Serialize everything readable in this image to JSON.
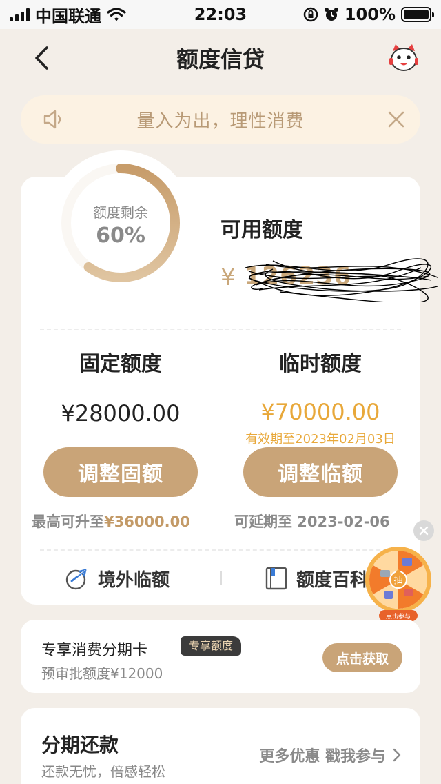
{
  "status_bar": {
    "carrier": "中国联通",
    "time": "22:03",
    "battery": "100%"
  },
  "nav": {
    "title": "额度信贷"
  },
  "notice": {
    "text": "量入为出，理性消费"
  },
  "credit": {
    "remaining_label": "额度剩余",
    "remaining_percent": "60%",
    "remaining_fraction": 0.6,
    "available_label": "可用额度",
    "currency": "¥",
    "available_amount_redacted": "126236"
  },
  "fixed": {
    "title": "固定额度",
    "amount": "¥28000.00",
    "button": "调整固额",
    "note_prefix": "最高可升至",
    "note_value": "¥36000.00"
  },
  "temporary": {
    "title": "临时额度",
    "amount": "¥70000.00",
    "expiry": "有效期至2023年02月03日",
    "button": "调整临额",
    "note": "可延期至 2023-02-06"
  },
  "quick_links": {
    "overseas": "境外临额",
    "encyclopedia": "额度百科"
  },
  "floating": {
    "wheel_center": "抽",
    "wheel_caption": "点击参与"
  },
  "installment_card": {
    "title": "专享消费分期卡",
    "badge": "专享额度",
    "subtitle": "预审批额度¥12000",
    "button": "点击获取"
  },
  "repayment": {
    "title": "分期还款",
    "subtitle": "还款无忧，倍感轻松",
    "link": "更多优惠 戳我参与"
  },
  "colors": {
    "gold": "#c9a478",
    "orange": "#e8a83a",
    "notice_bg": "#fcf2e3",
    "page_bg": "#f3eee8"
  }
}
